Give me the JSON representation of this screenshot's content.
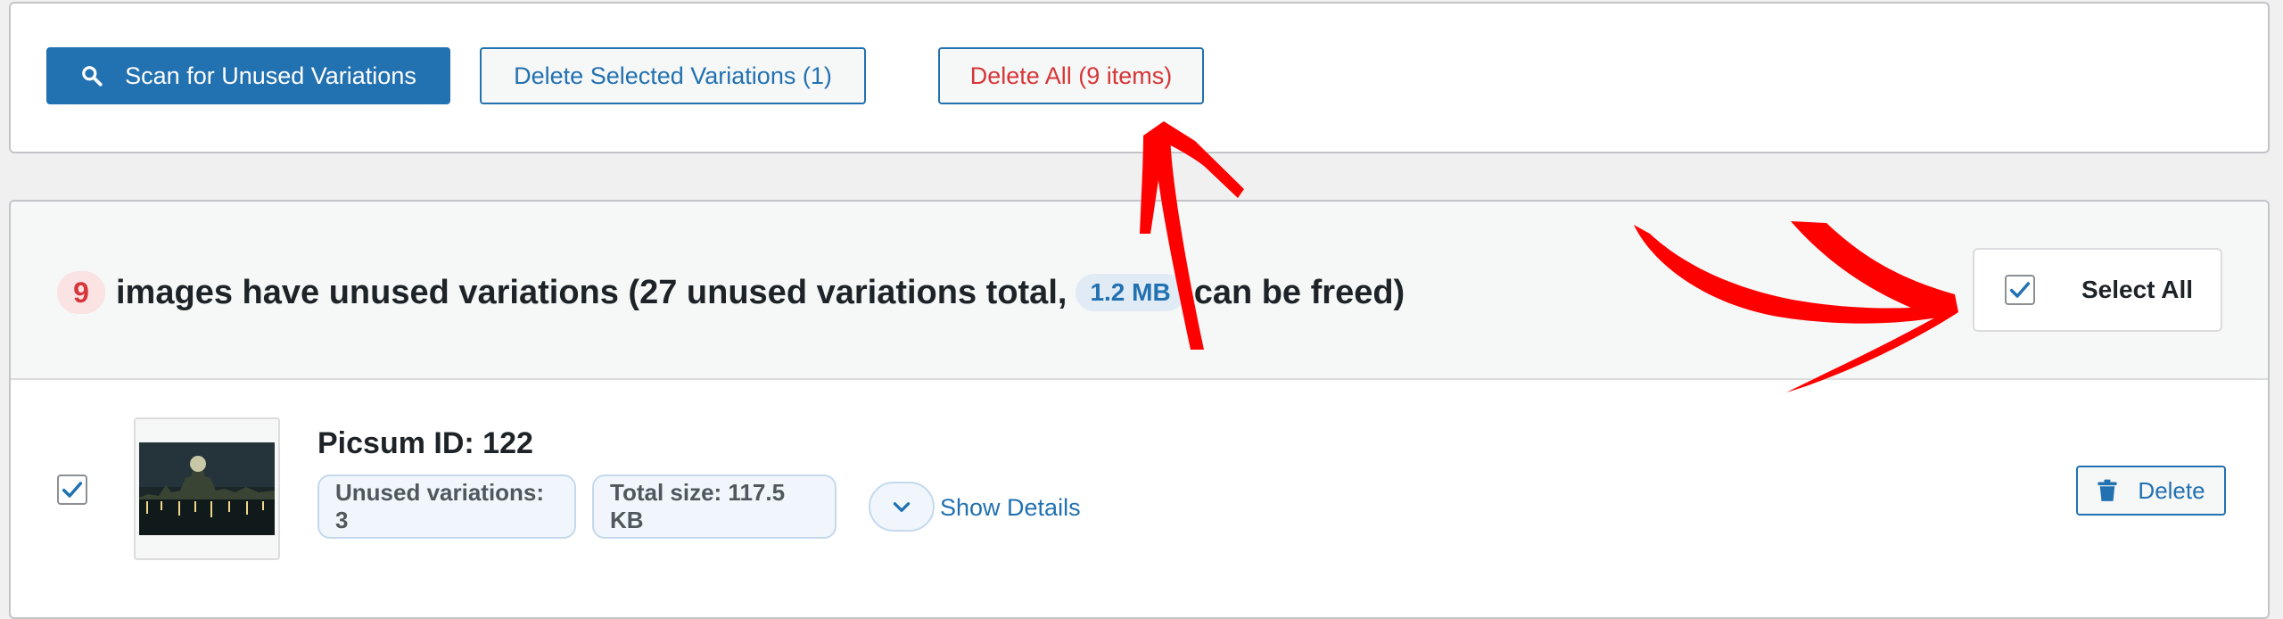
{
  "toolbar": {
    "scan_label": "Scan for Unused Variations",
    "delete_selected_label": "Delete Selected Variations (1)",
    "delete_all_label": "Delete All (9 items)"
  },
  "summary": {
    "count": "9",
    "text_before": "images have unused variations (27 unused variations total,",
    "size": "1.2 MB",
    "text_after": "can be freed)",
    "select_all_label": "Select All",
    "select_all_checked": true
  },
  "items": [
    {
      "title": "Picsum ID: 122",
      "unused_variations": "Unused variations: 3",
      "total_size": "Total size: 117.5 KB",
      "details_label": "Show Details",
      "delete_label": "Delete",
      "checked": true
    }
  ],
  "colors": {
    "accent": "#2271b1",
    "danger": "#d63638",
    "annotation": "#ff0000"
  },
  "icons": {
    "scan": "search-icon",
    "details_toggle": "chevron-down-icon",
    "delete": "trash-icon",
    "checkbox": "checkmark-icon"
  }
}
